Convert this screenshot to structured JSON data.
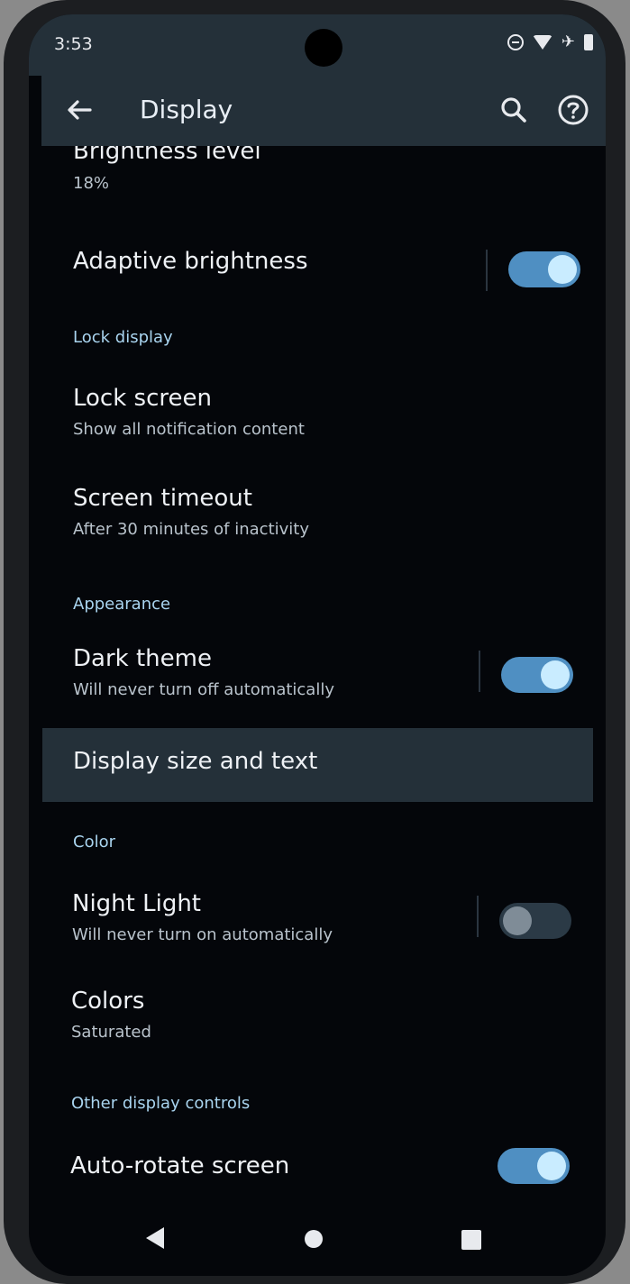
{
  "status_bar": {
    "time": "3:53",
    "icons": [
      "do-not-disturb-icon",
      "wifi-icon",
      "airplane-icon",
      "battery-icon"
    ]
  },
  "app_bar": {
    "title": "Display",
    "back_icon": "arrow-back-icon",
    "search_icon": "search-icon",
    "help_icon": "help-circle-icon"
  },
  "settings": {
    "brightness": {
      "title": "Brightness level",
      "summary": "18%"
    },
    "adaptive_brightness": {
      "title": "Adaptive brightness",
      "enabled": true
    },
    "lock_display_header": "Lock display",
    "lock_screen": {
      "title": "Lock screen",
      "summary": "Show all notification content"
    },
    "screen_timeout": {
      "title": "Screen timeout",
      "summary": "After 30 minutes of inactivity"
    },
    "appearance_header": "Appearance",
    "dark_theme": {
      "title": "Dark theme",
      "summary": "Will never turn off automatically",
      "enabled": true
    },
    "display_size": {
      "title": "Display size and text"
    },
    "color_header": "Color",
    "night_light": {
      "title": "Night Light",
      "summary": "Will never turn on automatically",
      "enabled": false
    },
    "colors": {
      "title": "Colors",
      "summary": "Saturated"
    },
    "other_header": "Other display controls",
    "auto_rotate": {
      "title": "Auto-rotate screen",
      "enabled": true
    }
  },
  "nav_bar": {
    "icons": [
      "nav-back-icon",
      "nav-home-icon",
      "nav-recents-icon"
    ]
  },
  "colors": {
    "accent": "#4f8fc2",
    "section_header": "#a9d4ef",
    "surface": "#243039",
    "background": "#04060a"
  }
}
